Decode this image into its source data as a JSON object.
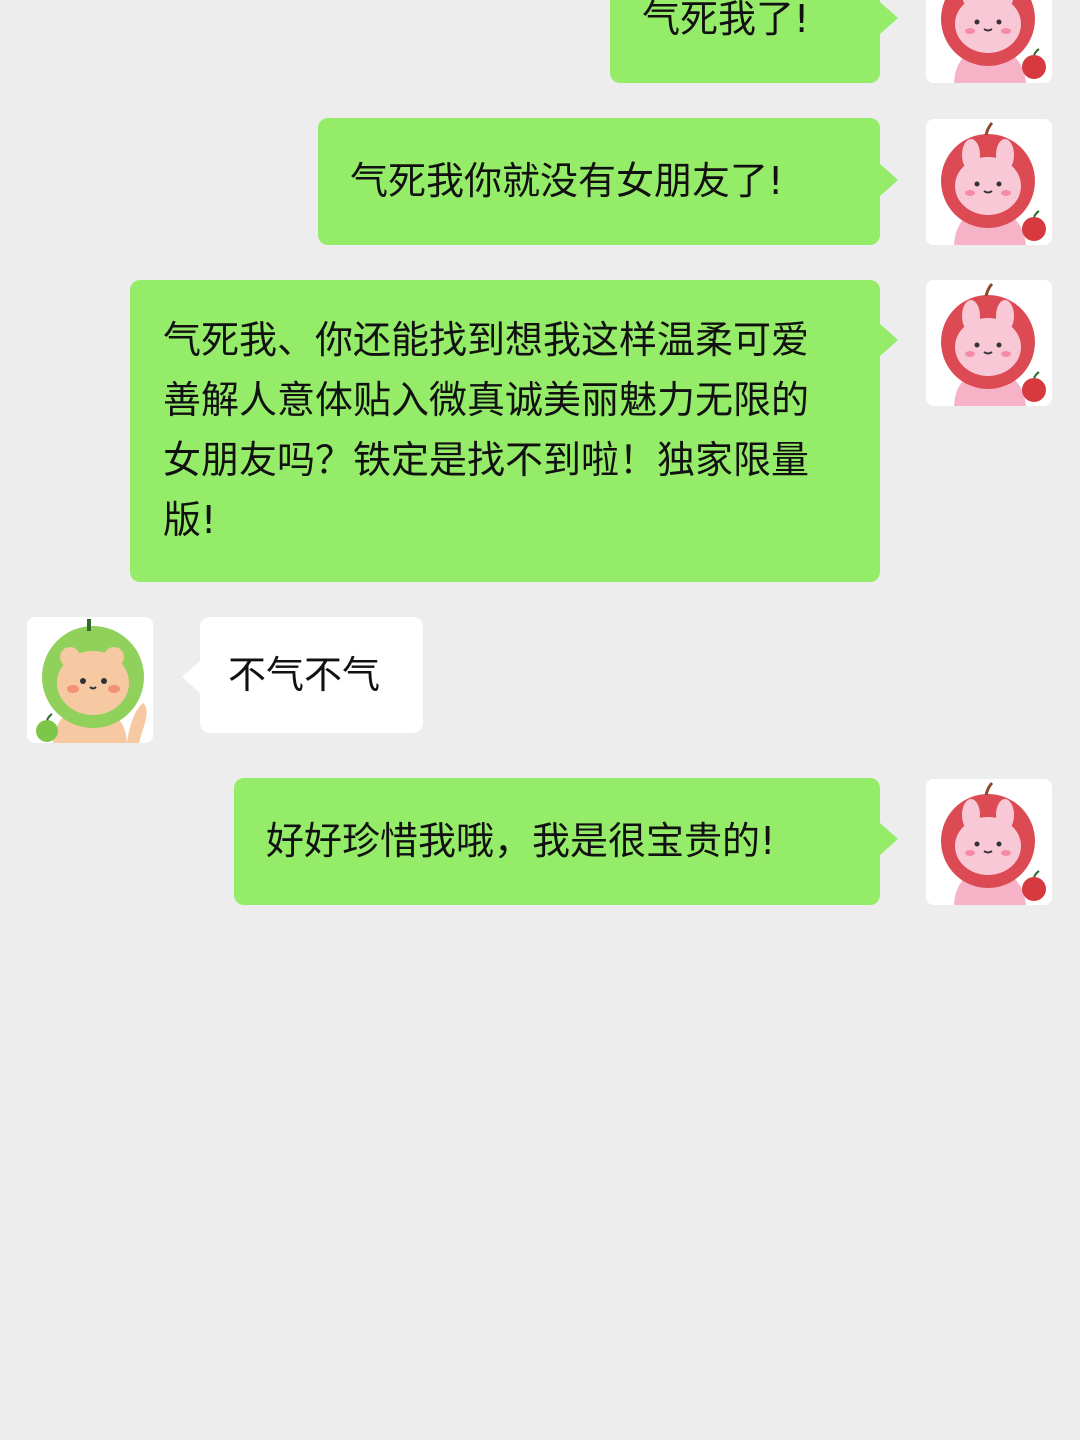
{
  "messages": [
    {
      "side": "sent",
      "text": "气死我了!"
    },
    {
      "side": "sent",
      "text": "气死我你就没有女朋友了!"
    },
    {
      "side": "sent",
      "text": "气死我、你还能找到想我这样温柔可爱善解人意体贴入微真诚美丽魅力无限的女朋友吗？铁定是找不到啦！独家限量版!"
    },
    {
      "side": "received",
      "text": "不气不气"
    },
    {
      "side": "sent",
      "text": "好好珍惜我哦，我是很宝贵的!"
    }
  ],
  "avatars": {
    "self": "pink-bunny-in-red-apple-icon",
    "other": "orange-bear-in-green-apple-icon"
  },
  "colors": {
    "background": "#ededed",
    "sent_bubble": "#95ec69",
    "received_bubble": "#ffffff"
  }
}
